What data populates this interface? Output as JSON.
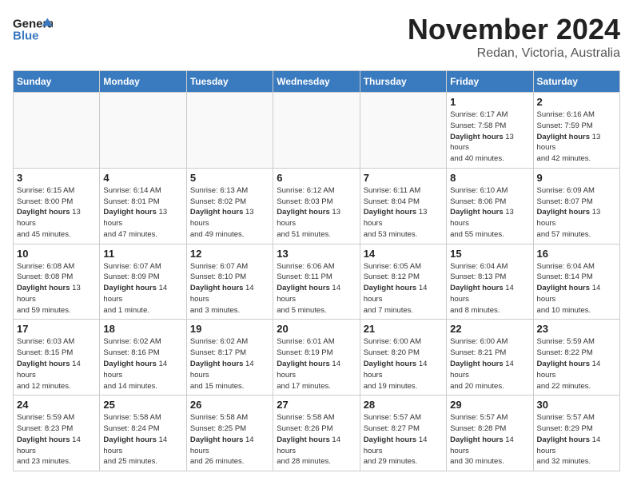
{
  "header": {
    "logo_line1": "General",
    "logo_line2": "Blue",
    "month": "November 2024",
    "location": "Redan, Victoria, Australia"
  },
  "days_of_week": [
    "Sunday",
    "Monday",
    "Tuesday",
    "Wednesday",
    "Thursday",
    "Friday",
    "Saturday"
  ],
  "weeks": [
    [
      {
        "day": "",
        "info": ""
      },
      {
        "day": "",
        "info": ""
      },
      {
        "day": "",
        "info": ""
      },
      {
        "day": "",
        "info": ""
      },
      {
        "day": "",
        "info": ""
      },
      {
        "day": "1",
        "info": "Sunrise: 6:17 AM\nSunset: 7:58 PM\nDaylight: 13 hours\nand 40 minutes."
      },
      {
        "day": "2",
        "info": "Sunrise: 6:16 AM\nSunset: 7:59 PM\nDaylight: 13 hours\nand 42 minutes."
      }
    ],
    [
      {
        "day": "3",
        "info": "Sunrise: 6:15 AM\nSunset: 8:00 PM\nDaylight: 13 hours\nand 45 minutes."
      },
      {
        "day": "4",
        "info": "Sunrise: 6:14 AM\nSunset: 8:01 PM\nDaylight: 13 hours\nand 47 minutes."
      },
      {
        "day": "5",
        "info": "Sunrise: 6:13 AM\nSunset: 8:02 PM\nDaylight: 13 hours\nand 49 minutes."
      },
      {
        "day": "6",
        "info": "Sunrise: 6:12 AM\nSunset: 8:03 PM\nDaylight: 13 hours\nand 51 minutes."
      },
      {
        "day": "7",
        "info": "Sunrise: 6:11 AM\nSunset: 8:04 PM\nDaylight: 13 hours\nand 53 minutes."
      },
      {
        "day": "8",
        "info": "Sunrise: 6:10 AM\nSunset: 8:06 PM\nDaylight: 13 hours\nand 55 minutes."
      },
      {
        "day": "9",
        "info": "Sunrise: 6:09 AM\nSunset: 8:07 PM\nDaylight: 13 hours\nand 57 minutes."
      }
    ],
    [
      {
        "day": "10",
        "info": "Sunrise: 6:08 AM\nSunset: 8:08 PM\nDaylight: 13 hours\nand 59 minutes."
      },
      {
        "day": "11",
        "info": "Sunrise: 6:07 AM\nSunset: 8:09 PM\nDaylight: 14 hours\nand 1 minute."
      },
      {
        "day": "12",
        "info": "Sunrise: 6:07 AM\nSunset: 8:10 PM\nDaylight: 14 hours\nand 3 minutes."
      },
      {
        "day": "13",
        "info": "Sunrise: 6:06 AM\nSunset: 8:11 PM\nDaylight: 14 hours\nand 5 minutes."
      },
      {
        "day": "14",
        "info": "Sunrise: 6:05 AM\nSunset: 8:12 PM\nDaylight: 14 hours\nand 7 minutes."
      },
      {
        "day": "15",
        "info": "Sunrise: 6:04 AM\nSunset: 8:13 PM\nDaylight: 14 hours\nand 8 minutes."
      },
      {
        "day": "16",
        "info": "Sunrise: 6:04 AM\nSunset: 8:14 PM\nDaylight: 14 hours\nand 10 minutes."
      }
    ],
    [
      {
        "day": "17",
        "info": "Sunrise: 6:03 AM\nSunset: 8:15 PM\nDaylight: 14 hours\nand 12 minutes."
      },
      {
        "day": "18",
        "info": "Sunrise: 6:02 AM\nSunset: 8:16 PM\nDaylight: 14 hours\nand 14 minutes."
      },
      {
        "day": "19",
        "info": "Sunrise: 6:02 AM\nSunset: 8:17 PM\nDaylight: 14 hours\nand 15 minutes."
      },
      {
        "day": "20",
        "info": "Sunrise: 6:01 AM\nSunset: 8:19 PM\nDaylight: 14 hours\nand 17 minutes."
      },
      {
        "day": "21",
        "info": "Sunrise: 6:00 AM\nSunset: 8:20 PM\nDaylight: 14 hours\nand 19 minutes."
      },
      {
        "day": "22",
        "info": "Sunrise: 6:00 AM\nSunset: 8:21 PM\nDaylight: 14 hours\nand 20 minutes."
      },
      {
        "day": "23",
        "info": "Sunrise: 5:59 AM\nSunset: 8:22 PM\nDaylight: 14 hours\nand 22 minutes."
      }
    ],
    [
      {
        "day": "24",
        "info": "Sunrise: 5:59 AM\nSunset: 8:23 PM\nDaylight: 14 hours\nand 23 minutes."
      },
      {
        "day": "25",
        "info": "Sunrise: 5:58 AM\nSunset: 8:24 PM\nDaylight: 14 hours\nand 25 minutes."
      },
      {
        "day": "26",
        "info": "Sunrise: 5:58 AM\nSunset: 8:25 PM\nDaylight: 14 hours\nand 26 minutes."
      },
      {
        "day": "27",
        "info": "Sunrise: 5:58 AM\nSunset: 8:26 PM\nDaylight: 14 hours\nand 28 minutes."
      },
      {
        "day": "28",
        "info": "Sunrise: 5:57 AM\nSunset: 8:27 PM\nDaylight: 14 hours\nand 29 minutes."
      },
      {
        "day": "29",
        "info": "Sunrise: 5:57 AM\nSunset: 8:28 PM\nDaylight: 14 hours\nand 30 minutes."
      },
      {
        "day": "30",
        "info": "Sunrise: 5:57 AM\nSunset: 8:29 PM\nDaylight: 14 hours\nand 32 minutes."
      }
    ]
  ]
}
